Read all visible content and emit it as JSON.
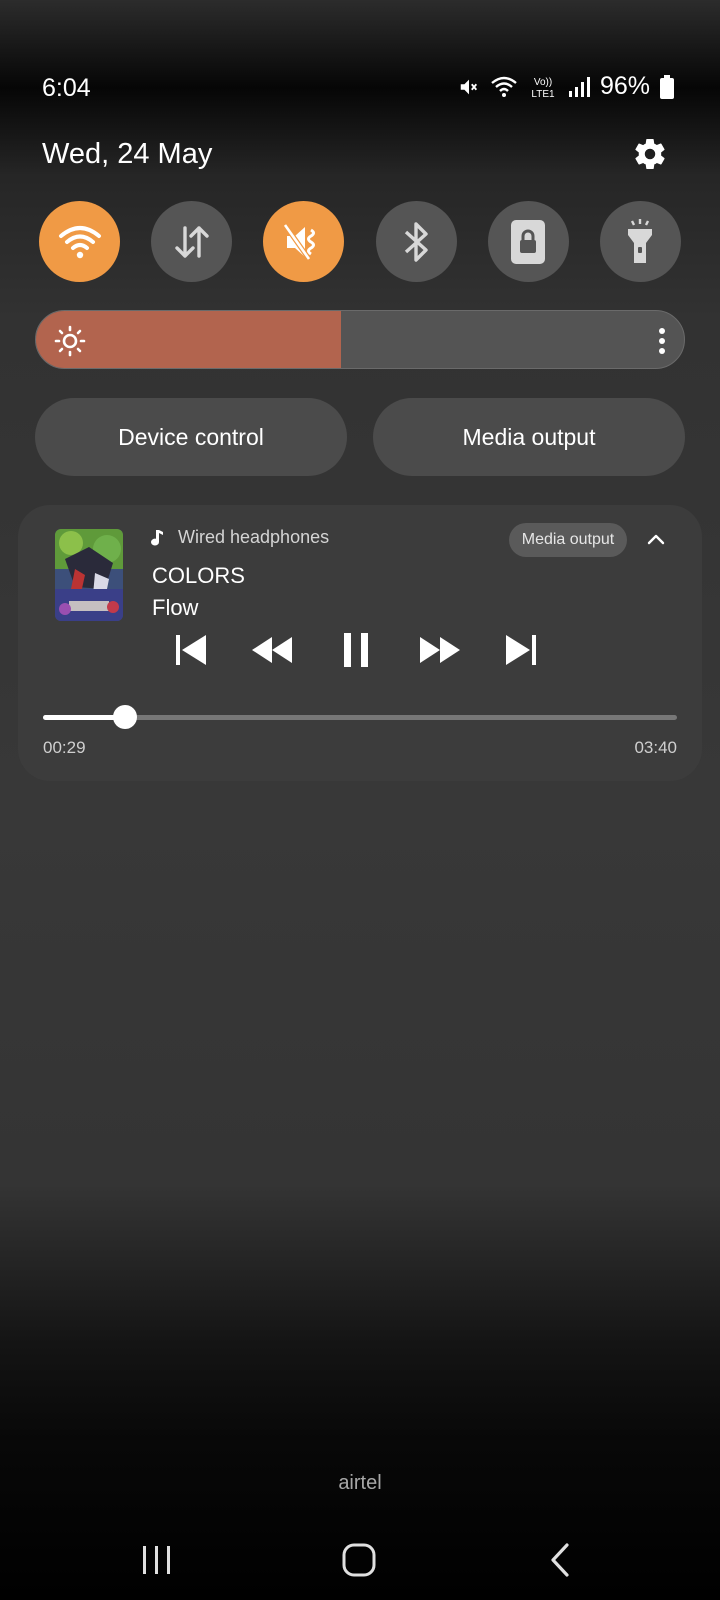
{
  "status_bar": {
    "time": "6:04",
    "battery": "96%",
    "network_badge": "Vo)) LTE1",
    "icons": [
      "mute-icon",
      "wifi-icon",
      "volte-icon",
      "signal-icon",
      "battery-icon"
    ]
  },
  "header": {
    "date": "Wed, 24 May",
    "settings_icon": "gear-icon"
  },
  "quick_settings": [
    {
      "name": "wifi",
      "icon": "wifi-icon",
      "active": true
    },
    {
      "name": "mobile-data",
      "icon": "data-arrows-icon",
      "active": false
    },
    {
      "name": "sound",
      "icon": "mute-icon",
      "active": true
    },
    {
      "name": "bluetooth",
      "icon": "bluetooth-icon",
      "active": false
    },
    {
      "name": "auto-rotate-lock",
      "icon": "lock-icon",
      "active": false
    },
    {
      "name": "flashlight",
      "icon": "flashlight-icon",
      "active": false
    }
  ],
  "brightness": {
    "level": 0.47,
    "accent": "#b2644e"
  },
  "buttons": {
    "device_control": "Device control",
    "media_output": "Media output"
  },
  "media": {
    "source": "Wired headphones",
    "output_chip": "Media output",
    "title": "COLORS",
    "artist": "Flow",
    "elapsed": "00:29",
    "duration": "03:40",
    "progress": 0.13
  },
  "carrier": "airtel",
  "colors": {
    "accent": "#f09a45",
    "tile_off": "#555555"
  }
}
